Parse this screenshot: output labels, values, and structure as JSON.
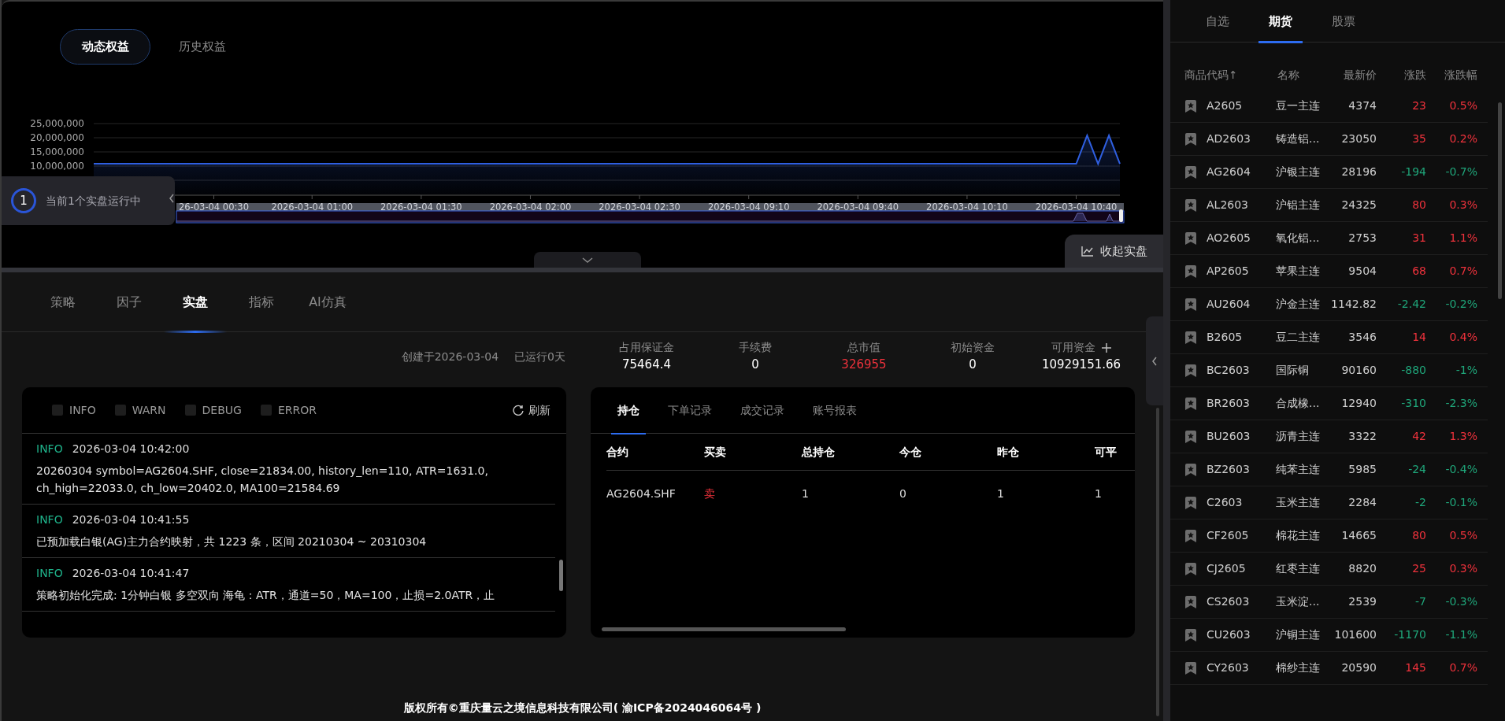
{
  "equity_tabs": [
    {
      "label": "动态权益",
      "selected": true
    },
    {
      "label": "历史权益",
      "selected": false
    }
  ],
  "equity_chart": {
    "chart_data": {
      "type": "area",
      "categories": [
        null,
        null,
        null,
        null,
        null,
        null,
        null,
        null,
        null,
        null,
        null,
        "26-03-04 00:30",
        null,
        null,
        null,
        null,
        null,
        null,
        null,
        null,
        "2026-03-04 01:00",
        null,
        null,
        null,
        null,
        null,
        null,
        null,
        null,
        null,
        "2026-03-04 01:30",
        null,
        null,
        null,
        null,
        null,
        null,
        null,
        null,
        null,
        "2026-03-04 02:00",
        null,
        null,
        null,
        null,
        null,
        null,
        null,
        null,
        null,
        "2026-03-04 02:30",
        null,
        null,
        null,
        null,
        null,
        null,
        null,
        null,
        null,
        "2026-03-04 09:10",
        null,
        null,
        null,
        null,
        null,
        null,
        null,
        null,
        null,
        "2026-03-04 09:40",
        null,
        null,
        null,
        null,
        null,
        null,
        null,
        null,
        null,
        "2026-03-04 10:10",
        null,
        null,
        null,
        null,
        null,
        null,
        null,
        null,
        null,
        "2026-03-04 10:40",
        null,
        null,
        null,
        null
      ],
      "series": [
        {
          "color": "#2f5fe0",
          "values": [
            10800000,
            10800000,
            10800000,
            10800000,
            10800000,
            10800000,
            10800000,
            10800000,
            10800000,
            10800000,
            10800000,
            10800000,
            10800000,
            10800000,
            10800000,
            10800000,
            10800000,
            10800000,
            10800000,
            10800000,
            10800000,
            10800000,
            10800000,
            10800000,
            10800000,
            10800000,
            10800000,
            10800000,
            10800000,
            10800000,
            10800000,
            10800000,
            10800000,
            10800000,
            10800000,
            10800000,
            10800000,
            10800000,
            10800000,
            10800000,
            10800000,
            10800000,
            10800000,
            10800000,
            10800000,
            10800000,
            10800000,
            10800000,
            10800000,
            10800000,
            10800000,
            10800000,
            10800000,
            10800000,
            10800000,
            10800000,
            10800000,
            10800000,
            10800000,
            10800000,
            10800000,
            10800000,
            10800000,
            10800000,
            10800000,
            10800000,
            10800000,
            10800000,
            10800000,
            10800000,
            10800000,
            10800000,
            10800000,
            10800000,
            10800000,
            10800000,
            10800000,
            10800000,
            10800000,
            10800000,
            10800000,
            10800000,
            10800000,
            10800000,
            10800000,
            10800000,
            10800000,
            10800000,
            10800000,
            10800000,
            10800000,
            20800000,
            10800000,
            20800000,
            10800000
          ]
        }
      ],
      "ylim": [
        0,
        25000000
      ],
      "yticks": [
        {
          "value": 10000000,
          "label": "10,000,000"
        },
        {
          "value": 15000000,
          "label": "15,000,000"
        },
        {
          "value": 20000000,
          "label": "20,000,000"
        },
        {
          "value": 25000000,
          "label": "25,000,000"
        }
      ],
      "grid": true
    }
  },
  "running_badge": {
    "count": "1",
    "text": "当前1个实盘运行中"
  },
  "collapse_button": {
    "label": "收起实盘"
  },
  "main_tabs": [
    {
      "label": "策略",
      "selected": false
    },
    {
      "label": "因子",
      "selected": false
    },
    {
      "label": "实盘",
      "selected": true
    },
    {
      "label": "指标",
      "selected": false
    },
    {
      "label": "AI仿真",
      "selected": false
    }
  ],
  "live_info": {
    "created": "创建于2026-03-04",
    "running": "已运行0天"
  },
  "stats": [
    {
      "label": "占用保证金",
      "value": "75464.4",
      "color": "#ffffff",
      "addable": false
    },
    {
      "label": "手续费",
      "value": "0",
      "color": "#ffffff",
      "addable": false
    },
    {
      "label": "总市值",
      "value": "326955",
      "color": "#f0323c",
      "addable": false
    },
    {
      "label": "初始资金",
      "value": "0",
      "color": "#ffffff",
      "addable": false
    },
    {
      "label": "可用资金",
      "value": "10929151.66",
      "color": "#ffffff",
      "addable": true
    }
  ],
  "log_panel": {
    "filters": [
      {
        "label": "INFO",
        "checked": false
      },
      {
        "label": "WARN",
        "checked": false
      },
      {
        "label": "DEBUG",
        "checked": false
      },
      {
        "label": "ERROR",
        "checked": false
      }
    ],
    "refresh": "刷新",
    "entries": [
      {
        "level": "INFO",
        "time": "2026-03-04 10:42:00",
        "message": "20260304 symbol=AG2604.SHF, close=21834.00, history_len=110, ATR=1631.0, ch_high=22033.0, ch_low=20402.0, MA100=21584.69"
      },
      {
        "level": "INFO",
        "time": "2026-03-04 10:41:55",
        "message": "已预加载白银(AG)主力合约映射，共 1223 条，区间 20210304 ~ 20310304"
      },
      {
        "level": "INFO",
        "time": "2026-03-04 10:41:47",
        "message": "策略初始化完成: 1分钟白银 多空双向 海龟：ATR，通道=50，MA=100，止损=2.0ATR，止"
      }
    ]
  },
  "positions_panel": {
    "tabs": [
      {
        "label": "持仓",
        "selected": true
      },
      {
        "label": "下单记录",
        "selected": false
      },
      {
        "label": "成交记录",
        "selected": false
      },
      {
        "label": "账号报表",
        "selected": false
      }
    ],
    "columns": [
      "合约",
      "买卖",
      "总持仓",
      "今仓",
      "昨仓",
      "可平"
    ],
    "rows": [
      {
        "cells": [
          "AG2604.SHF",
          "卖",
          "1",
          "0",
          "1",
          "1"
        ],
        "color": "#f0323c"
      }
    ]
  },
  "footer": "版权所有©重庆量云之境信息科技有限公司( 渝ICP备2024046064号 )",
  "market_panel": {
    "tabs": [
      {
        "label": "自选",
        "selected": false
      },
      {
        "label": "期货",
        "selected": true
      },
      {
        "label": "股票",
        "selected": false
      }
    ],
    "columns": [
      "商品代码↑",
      "名称",
      "最新价",
      "涨跌",
      "涨跌幅"
    ],
    "rows": [
      {
        "code": "A2605",
        "name": "豆一主连",
        "price": "4374",
        "change": "23",
        "pct": "0.5%",
        "color": "#f0323c"
      },
      {
        "code": "AD2603",
        "name": "铸造铝...",
        "price": "23050",
        "change": "35",
        "pct": "0.2%",
        "color": "#f0323c"
      },
      {
        "code": "AG2604",
        "name": "沪银主连",
        "price": "28196",
        "change": "-194",
        "pct": "-0.7%",
        "color": "#1fa67a"
      },
      {
        "code": "AL2603",
        "name": "沪铝主连",
        "price": "24325",
        "change": "80",
        "pct": "0.3%",
        "color": "#f0323c"
      },
      {
        "code": "AO2605",
        "name": "氧化铝...",
        "price": "2753",
        "change": "31",
        "pct": "1.1%",
        "color": "#f0323c"
      },
      {
        "code": "AP2605",
        "name": "苹果主连",
        "price": "9504",
        "change": "68",
        "pct": "0.7%",
        "color": "#f0323c"
      },
      {
        "code": "AU2604",
        "name": "沪金主连",
        "price": "1142.82",
        "change": "-2.42",
        "pct": "-0.2%",
        "color": "#1fa67a"
      },
      {
        "code": "B2605",
        "name": "豆二主连",
        "price": "3546",
        "change": "14",
        "pct": "0.4%",
        "color": "#f0323c"
      },
      {
        "code": "BC2603",
        "name": "国际铜",
        "price": "90160",
        "change": "-880",
        "pct": "-1%",
        "color": "#1fa67a"
      },
      {
        "code": "BR2603",
        "name": "合成橡...",
        "price": "12940",
        "change": "-310",
        "pct": "-2.3%",
        "color": "#1fa67a"
      },
      {
        "code": "BU2603",
        "name": "沥青主连",
        "price": "3322",
        "change": "42",
        "pct": "1.3%",
        "color": "#f0323c"
      },
      {
        "code": "BZ2603",
        "name": "纯苯主连",
        "price": "5985",
        "change": "-24",
        "pct": "-0.4%",
        "color": "#1fa67a"
      },
      {
        "code": "C2603",
        "name": "玉米主连",
        "price": "2284",
        "change": "-2",
        "pct": "-0.1%",
        "color": "#1fa67a"
      },
      {
        "code": "CF2605",
        "name": "棉花主连",
        "price": "14665",
        "change": "80",
        "pct": "0.5%",
        "color": "#f0323c"
      },
      {
        "code": "CJ2605",
        "name": "红枣主连",
        "price": "8820",
        "change": "25",
        "pct": "0.3%",
        "color": "#f0323c"
      },
      {
        "code": "CS2603",
        "name": "玉米淀...",
        "price": "2539",
        "change": "-7",
        "pct": "-0.3%",
        "color": "#1fa67a"
      },
      {
        "code": "CU2603",
        "name": "沪铜主连",
        "price": "101600",
        "change": "-1170",
        "pct": "-1.1%",
        "color": "#1fa67a"
      },
      {
        "code": "CY2603",
        "name": "棉纱主连",
        "price": "20590",
        "change": "145",
        "pct": "0.7%",
        "color": "#f0323c"
      }
    ]
  }
}
